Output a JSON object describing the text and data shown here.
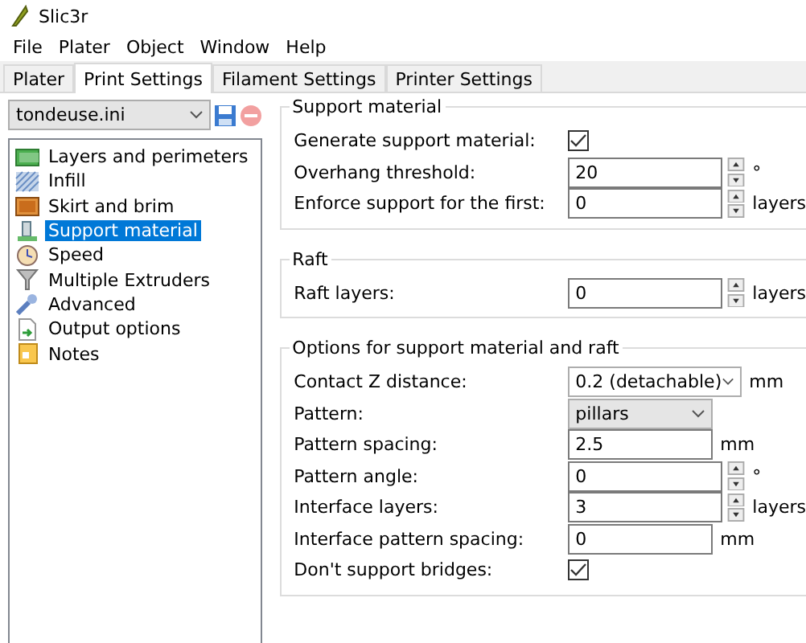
{
  "window": {
    "title": "Slic3r"
  },
  "menu": [
    "File",
    "Plater",
    "Object",
    "Window",
    "Help"
  ],
  "tabs": [
    {
      "label": "Plater",
      "selected": false
    },
    {
      "label": "Print Settings",
      "selected": true
    },
    {
      "label": "Filament Settings",
      "selected": false
    },
    {
      "label": "Printer Settings",
      "selected": false
    }
  ],
  "preset": {
    "value": "tondeuse.ini"
  },
  "sidebar": {
    "items": [
      {
        "label": "Layers and perimeters",
        "selected": false
      },
      {
        "label": "Infill",
        "selected": false
      },
      {
        "label": "Skirt and brim",
        "selected": false
      },
      {
        "label": "Support material",
        "selected": true
      },
      {
        "label": "Speed",
        "selected": false
      },
      {
        "label": "Multiple Extruders",
        "selected": false
      },
      {
        "label": "Advanced",
        "selected": false
      },
      {
        "label": "Output options",
        "selected": false
      },
      {
        "label": "Notes",
        "selected": false
      }
    ]
  },
  "groups": [
    {
      "title": "Support material",
      "rows": [
        {
          "kind": "checkbox",
          "label": "Generate support material:",
          "checked": true
        },
        {
          "kind": "spin",
          "label": "Overhang threshold:",
          "value": "20",
          "unit": "°"
        },
        {
          "kind": "spin",
          "label": "Enforce support for the first:",
          "value": "0",
          "unit": "layers"
        }
      ]
    },
    {
      "title": "Raft",
      "rows": [
        {
          "kind": "spin",
          "label": "Raft layers:",
          "value": "0",
          "unit": "layers"
        }
      ]
    },
    {
      "title": "Options for support material and raft",
      "rows": [
        {
          "kind": "select",
          "label": "Contact Z distance:",
          "value": "0.2 (detachable)",
          "unit": "mm"
        },
        {
          "kind": "choice",
          "label": "Pattern:",
          "value": "pillars"
        },
        {
          "kind": "text",
          "label": "Pattern spacing:",
          "value": "2.5",
          "unit": "mm"
        },
        {
          "kind": "spin",
          "label": "Pattern angle:",
          "value": "0",
          "unit": "°"
        },
        {
          "kind": "spin",
          "label": "Interface layers:",
          "value": "3",
          "unit": "layers"
        },
        {
          "kind": "text",
          "label": "Interface pattern spacing:",
          "value": "0",
          "unit": "mm"
        },
        {
          "kind": "checkbox",
          "label": "Don't support bridges:",
          "checked": true
        }
      ]
    }
  ]
}
